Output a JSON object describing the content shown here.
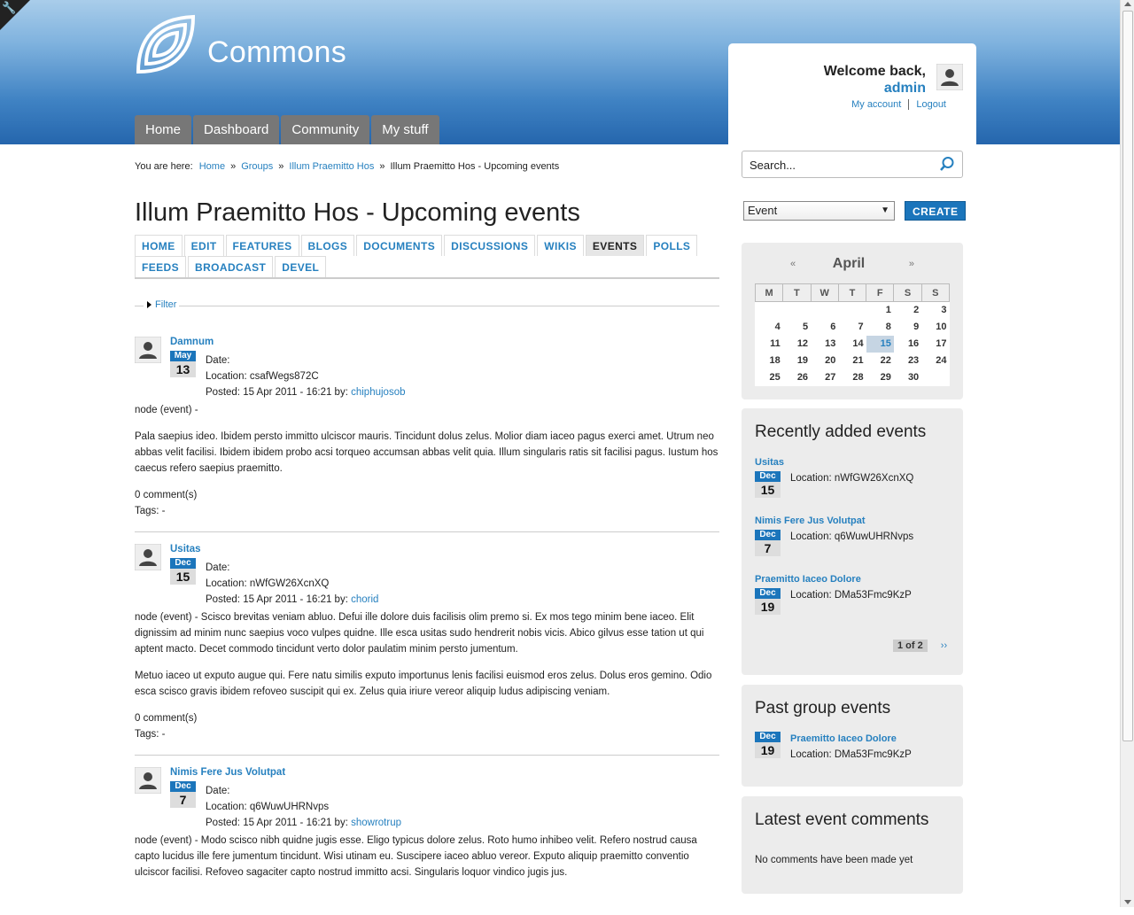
{
  "site": {
    "name": "Commons"
  },
  "main_nav": [
    "Home",
    "Dashboard",
    "Community",
    "My stuff"
  ],
  "user": {
    "welcome": "Welcome back,",
    "name": "admin",
    "links": [
      "My account",
      "Logout"
    ]
  },
  "search": {
    "placeholder": "Search..."
  },
  "create": {
    "type_selected": "Event",
    "button": "CREATE"
  },
  "breadcrumb": {
    "prefix": "You are here:",
    "items": [
      "Home",
      "Groups",
      "Illum Praemitto Hos",
      "Illum Praemitto Hos - Upcoming events"
    ],
    "separator": "»"
  },
  "page_title": "Illum Praemitto Hos - Upcoming events",
  "tabs": {
    "row1": [
      "HOME",
      "EDIT",
      "FEATURES",
      "BLOGS",
      "DOCUMENTS",
      "DISCUSSIONS",
      "WIKIS",
      "EVENTS",
      "POLLS"
    ],
    "row2": [
      "FEEDS",
      "BROADCAST",
      "DEVEL"
    ],
    "active": "EVENTS"
  },
  "filter": {
    "label": "Filter"
  },
  "events": [
    {
      "title": "Damnum",
      "month": "May",
      "day": "13",
      "date_label": "Date:",
      "location": "Location: csafWegs872C",
      "posted": "Posted: 15 Apr 2011 - 16:21 by:",
      "author": "chiphujosob",
      "paragraphs": [
        "node (event) -",
        "Pala saepius ideo. Ibidem persto immitto ulciscor mauris. Tincidunt dolus zelus. Molior diam iaceo pagus exerci amet. Utrum neo abbas velit facilisi. Ibidem ibidem probo acsi torqueo accumsan abbas velit quia. Illum singularis ratis sit facilisi pagus. Iustum hos caecus refero saepius praemitto."
      ],
      "comments": "0 comment(s)",
      "tags": "Tags: -"
    },
    {
      "title": "Usitas",
      "month": "Dec",
      "day": "15",
      "date_label": "Date:",
      "location": "Location: nWfGW26XcnXQ",
      "posted": "Posted: 15 Apr 2011 - 16:21 by:",
      "author": "chorid",
      "paragraphs": [
        "node (event) - Scisco brevitas veniam abluo. Defui ille dolore duis facilisis olim premo si. Ex mos tego minim bene iaceo. Elit dignissim ad minim nunc saepius voco vulpes quidne. Ille esca usitas sudo hendrerit nobis vicis. Abico gilvus esse tation ut qui aptent macto. Decet commodo tincidunt verto dolor paulatim minim persto jumentum.",
        "Metuo iaceo ut exputo augue qui. Fere natu similis exputo importunus lenis facilisi euismod eros zelus. Dolus eros gemino. Odio esca scisco gravis ibidem refoveo suscipit qui ex. Zelus quia iriure vereor aliquip ludus adipiscing veniam."
      ],
      "comments": "0 comment(s)",
      "tags": "Tags: -"
    },
    {
      "title": "Nimis Fere Jus Volutpat",
      "month": "Dec",
      "day": "7",
      "date_label": "Date:",
      "location": "Location: q6WuwUHRNvps",
      "posted": "Posted: 15 Apr 2011 - 16:21 by:",
      "author": "showrotrup",
      "paragraphs": [
        "node (event) - Modo scisco nibh quidne jugis esse. Eligo typicus dolore zelus. Roto humo inhibeo velit. Refero nostrud causa capto lucidus ille fere jumentum tincidunt. Wisi utinam eu. Suscipere iaceo abluo vereor. Exputo aliquip praemitto conventio ulciscor facilisi. Refoveo sagaciter capto nostrud immitto acsi. Singularis loquor vindico jugis jus."
      ],
      "comments": "",
      "tags": ""
    }
  ],
  "calendar": {
    "prev": "«",
    "next": "»",
    "month": "April",
    "weekdays": [
      "M",
      "T",
      "W",
      "T",
      "F",
      "S",
      "S"
    ],
    "weeks": [
      [
        "",
        "",
        "",
        "",
        "1",
        "2",
        "3"
      ],
      [
        "4",
        "5",
        "6",
        "7",
        "8",
        "9",
        "10"
      ],
      [
        "11",
        "12",
        "13",
        "14",
        "15",
        "16",
        "17"
      ],
      [
        "18",
        "19",
        "20",
        "21",
        "22",
        "23",
        "24"
      ],
      [
        "25",
        "26",
        "27",
        "28",
        "29",
        "30",
        ""
      ]
    ],
    "today": "15"
  },
  "recent": {
    "title": "Recently added events",
    "items": [
      {
        "title": "Usitas",
        "month": "Dec",
        "day": "15",
        "location": "Location: nWfGW26XcnXQ"
      },
      {
        "title": "Nimis Fere Jus Volutpat",
        "month": "Dec",
        "day": "7",
        "location": "Location: q6WuwUHRNvps"
      },
      {
        "title": "Praemitto Iaceo Dolore",
        "month": "Dec",
        "day": "19",
        "location": "Location: DMa53Fmc9KzP"
      }
    ],
    "pager": {
      "current": "1 of 2",
      "next": "››"
    }
  },
  "past": {
    "title": "Past group events",
    "item": {
      "title": "Praemitto Iaceo Dolore",
      "month": "Dec",
      "day": "19",
      "location": "Location: DMa53Fmc9KzP"
    }
  },
  "latest_comments": {
    "title": "Latest event comments",
    "empty": "No comments have been made yet"
  }
}
